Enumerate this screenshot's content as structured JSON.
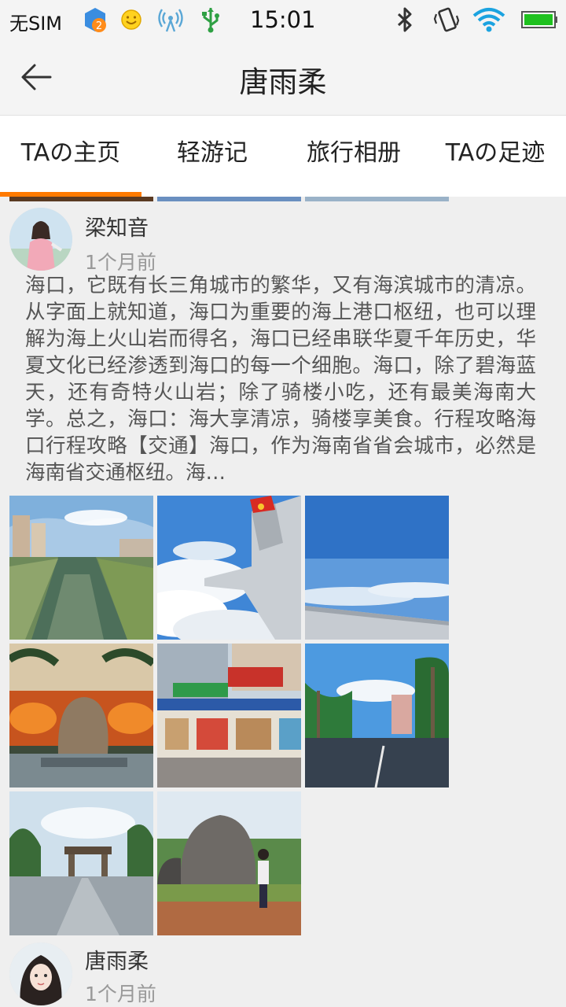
{
  "status_bar": {
    "carrier": "无SIM",
    "notification_count": "2",
    "time": "15:01",
    "icons": [
      "app-notification-icon",
      "smiley-icon",
      "signal-antenna-icon",
      "usb-icon",
      "bluetooth-icon",
      "vibrate-icon",
      "wifi-icon",
      "battery-icon"
    ]
  },
  "header": {
    "back_icon": "back-arrow-icon",
    "title": "唐雨柔"
  },
  "tabs": [
    {
      "label": "TAの主页",
      "active": true
    },
    {
      "label": "轻游记",
      "active": false
    },
    {
      "label": "旅行相册",
      "active": false
    },
    {
      "label": "TAの足迹",
      "active": false
    }
  ],
  "accent_color": "#ff7a00",
  "posts": [
    {
      "author": "梁知音",
      "time": "1个月前",
      "text": "海口，它既有长三角城市的繁华，又有海滨城市的清凉。从字面上就知道，海口为重要的海上港口枢纽，也可以理解为海上火山岩而得名，海口已经串联华夏千年历史，华夏文化已经渗透到海口的每一个细胞。海口，除了碧海蓝天，还有奇特火山岩；除了骑楼小吃，还有最美海南大学。总之，海口：海大享清凉，骑楼享美食。行程攻略海口行程攻略【交通】海口，作为海南省省会城市，必然是海南省交通枢纽。海…",
      "photos": [
        "canal-photo",
        "airplane-wing-photo",
        "sky-from-plane-photo",
        "stone-monument-night-photo",
        "street-market-photo",
        "palm-road-photo",
        "campus-gate-photo",
        "stone-with-person-photo"
      ]
    },
    {
      "author": "唐雨柔",
      "time": "1个月前"
    }
  ]
}
